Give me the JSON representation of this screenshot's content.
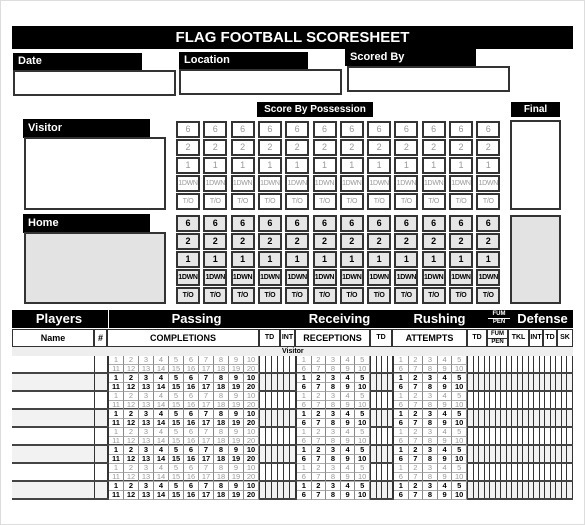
{
  "title": "FLAG FOOTBALL SCORESHEET",
  "info_fields": [
    {
      "label": "Date",
      "value": ""
    },
    {
      "label": "Location",
      "value": ""
    },
    {
      "label": "Scored By",
      "value": ""
    }
  ],
  "score_by_possession_label": "Score By Possession",
  "final_label": "Final",
  "teams": [
    {
      "label": "Visitor",
      "name_value": "",
      "final_value": ""
    },
    {
      "label": "Home",
      "name_value": "",
      "final_value": ""
    }
  ],
  "possession_columns": 12,
  "possession_options": [
    "6",
    "2",
    "1",
    "1DWN",
    "T/O"
  ],
  "table": {
    "sections": [
      "Players",
      "Passing",
      "Receiving",
      "Rushing",
      "Defense"
    ],
    "fum_pen_header": [
      "FUM",
      "PEN"
    ],
    "columns": {
      "name": "Name",
      "number": "#",
      "completions": "COMPLETIONS",
      "pass_td": "TD",
      "pass_int": "INT",
      "receptions": "RECEPTIONS",
      "rec_td": "TD",
      "attempts": "ATTEMPTS",
      "rush_td": "TD",
      "fum": "FUM",
      "pen": "PEN",
      "tkl": "TKL",
      "def_int": "INT",
      "def_td": "TD",
      "sk": "SK"
    },
    "team_row_label": "Visitor",
    "completions_numbers": [
      "1",
      "2",
      "3",
      "4",
      "5",
      "6",
      "7",
      "8",
      "9",
      "10",
      "11",
      "12",
      "13",
      "14",
      "15",
      "16",
      "17",
      "18",
      "19",
      "20"
    ],
    "receptions_numbers": [
      "1",
      "2",
      "3",
      "4",
      "5",
      "6",
      "7",
      "8",
      "9",
      "10"
    ],
    "attempts_numbers": [
      "1",
      "2",
      "3",
      "4",
      "5",
      "6",
      "7",
      "8",
      "9",
      "10"
    ],
    "player_rows": 8
  }
}
